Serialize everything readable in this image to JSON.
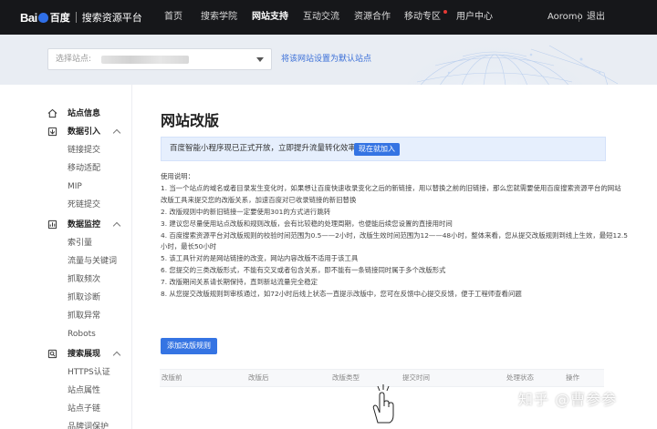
{
  "brand": {
    "bai": "Bai",
    "du": "百度",
    "title": "搜索资源平台"
  },
  "nav": {
    "items": [
      "首页",
      "搜索学院",
      "网站支持",
      "互动交流",
      "资源合作",
      "移动专区",
      "用户中心"
    ],
    "active_index": 2,
    "username": "Aoromo",
    "logout": "退出"
  },
  "banner": {
    "site_label": "选择站点:",
    "set_default_link": "将该网站设置为默认站点"
  },
  "sidebar": {
    "sections": [
      {
        "label": "站点信息",
        "icon": "home-icon",
        "items": []
      },
      {
        "label": "数据引入",
        "icon": "data-import-icon",
        "expanded": true,
        "items": [
          "链接提交",
          "移动适配",
          "MIP",
          "死链提交"
        ]
      },
      {
        "label": "数据监控",
        "icon": "monitor-icon",
        "expanded": true,
        "items": [
          "索引量",
          "流量与关键词",
          "抓取频次",
          "抓取诊断",
          "抓取异常",
          "Robots"
        ]
      },
      {
        "label": "搜索展现",
        "icon": "search-display-icon",
        "expanded": true,
        "items": [
          "HTTPS认证",
          "站点属性",
          "站点子链",
          "品牌词保护"
        ]
      }
    ]
  },
  "main": {
    "title": "网站改版",
    "notice": {
      "text": "百度智能小程序现已正式开放，立即提升流量转化效率",
      "button": "现在就加入"
    },
    "instructions": [
      "使用说明：",
      "1. 当一个站点的域名或者目录发生变化时，如果想让百度快速收录变化之后的新链接，用以替换之前的旧链接，那么您就需要使用百度搜索资源平台的网站",
      "改版工具来提交您的改版关系，加速百度对已收录链接的新旧替换",
      "2. 改版规则中的新旧链接一定要使用301的方式进行跳转",
      "3. 建议您尽量使用站点改版和规则改版，会有比较稳的处理周期，也便能后续您设置的直接用时间",
      "4. 百度搜索资源平台对改版规则的校验时间范围为0.5——2小时，改版生效时间范围为12——48小时，整体来看，您从提交改版规则到线上生效，最短12.5",
      "小时，最长50小时",
      "5. 该工具针对的是网站链接的改变，网站内容改版不适用于该工具",
      "6. 您提交的三类改版形式，不能有交叉或者包含关系，即不能有一条链接同时属于多个改版形式",
      "7. 改版期间关系请长期保持，直到新站流量完全稳定",
      "8. 从您提交改版规则到审核通过，如72小时后线上状态一直提示改版中，您可在反馈中心提交反馈，便于工程师查看问题"
    ],
    "add_button": "添加改版规则",
    "table_headers": [
      "改版前",
      "改版后",
      "改版类型",
      "提交时间",
      "处理状态",
      "操作"
    ]
  },
  "watermark": "知乎 @曹参参",
  "colors": {
    "nav_bg": "#16171a",
    "accent": "#3574e3",
    "banner_bg": "#e9edf3"
  }
}
